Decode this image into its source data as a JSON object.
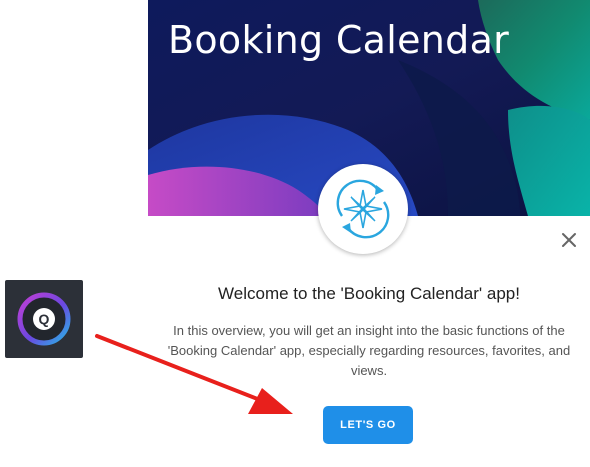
{
  "hero": {
    "title": "Booking Calendar",
    "logo_icon": "compass-cycle-icon"
  },
  "dialog": {
    "close_icon": "close-icon",
    "welcome_title": "Welcome to the 'Booking Calendar' app!",
    "intro_text": "In this overview, you will get an insight into the basic functions of the 'Booking Calendar' app, especially regarding resources, favorites, and views.",
    "cta_label": "LET'S GO"
  },
  "app_tile": {
    "icon": "q-logo-icon",
    "letter": "Q"
  },
  "colors": {
    "accent": "#1f8fe8",
    "hero_dark": "#0e1550",
    "hero_green": "#0a8f7a",
    "hero_purple": "#b53fc0",
    "annotation_arrow": "#e8201c"
  }
}
